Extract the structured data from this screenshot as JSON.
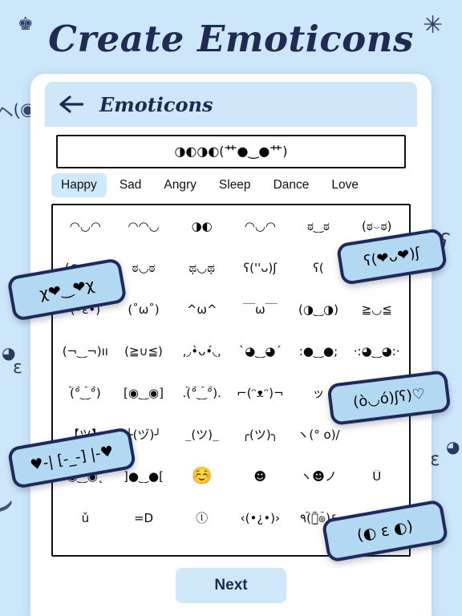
{
  "page": {
    "title": "Create Emoticons",
    "background_color": "#cde7fa",
    "accent_color": "#20295c",
    "tab_active_color": "#cfe9fb"
  },
  "decorations": [
    {
      "name": "crown-icon",
      "glyph": "♚"
    },
    {
      "name": "asterisk-icon",
      "glyph": "✳"
    },
    {
      "name": "emoticon-deco-left",
      "glyph": "ヘ(◉ω◉"
    },
    {
      "name": "dot-icon-left",
      "glyph": "◕"
    },
    {
      "name": "epsilon-deco-left",
      "glyph": "ε"
    },
    {
      "name": "swirl-deco-right",
      "glyph": "ʕ"
    },
    {
      "name": "dot-icon-right",
      "glyph": "◕"
    },
    {
      "name": "epsilon-deco-right",
      "glyph": "ε"
    },
    {
      "name": "arc-deco",
      "glyph": "⌣"
    }
  ],
  "app": {
    "back_label": "back-arrow",
    "title": "Emoticons",
    "input": {
      "value": "◑◐◑◐(艹●‿●艹)",
      "placeholder": "Type emoticon"
    },
    "tabs": [
      {
        "label": "Happy",
        "active": true
      },
      {
        "label": "Sad",
        "active": false
      },
      {
        "label": "Angry",
        "active": false
      },
      {
        "label": "Sleep",
        "active": false
      },
      {
        "label": "Dance",
        "active": false
      },
      {
        "label": "Love",
        "active": false
      }
    ],
    "grid": [
      [
        "◠◡◠",
        "◠◠◡",
        "◑◐",
        "◠◡◠",
        "ಠ‿ಠ",
        "(ಠ⌣ಠ)"
      ],
      [
        "(◐◡◑)",
        "ಠ◡ಠ",
        "ಥ◡ಥ",
        "ʕ(''ᴗ)ʃ",
        "ʕ(",
        "",
        ""
      ],
      [
        "(•ε•)",
        "(˚ω˚)",
        "^ω^",
        "￣ω￣",
        "(◑‿◑)",
        "≧◡≦"
      ],
      [
        "(¬‿¬)ıı",
        "(≧∪≦)",
        "‚◞•̀ᴗ•́◟‚",
        "`◕‿◕´",
        ":●‿●;",
        "·:◕‿◕:·"
      ],
      [
        "(͡°‿͡°)",
        "[◉‿◉]",
        ".(͡°‿͡°).",
        "⌐(ᵔᴥᵔ)¬",
        "ッ",
        ""
      ],
      [
        "【ツ】",
        "╰(ヅ)╯",
        "_(ツ)_",
        "╭(ツ)╮",
        "ヽ(° o)/",
        ""
      ],
      [
        "◉‿◉˛",
        "]●‿●[",
        "☺️",
        "☻",
        "ヽ☻ノ",
        "Ü"
      ],
      [
        "ǔ",
        "=D",
        "ⓛ",
        "‹(•¿•)›",
        "٩(͡๏̯͡๏)۶",
        ""
      ]
    ],
    "next_label": "Next"
  },
  "stickers": [
    {
      "name": "sticker-heart-eyes",
      "text": "χ❤‿❤χ"
    },
    {
      "name": "sticker-hug-hearts",
      "text": "ʕ(❤ᴗ❤)ʃ"
    },
    {
      "name": "sticker-love-hug",
      "text": "(ò◡ó)ʃʕ)♡"
    },
    {
      "name": "sticker-heart-arms",
      "text": "♥-| [-_-] |-♥"
    },
    {
      "name": "sticker-kiss-face",
      "text": "(◐ ε ◐)"
    }
  ]
}
